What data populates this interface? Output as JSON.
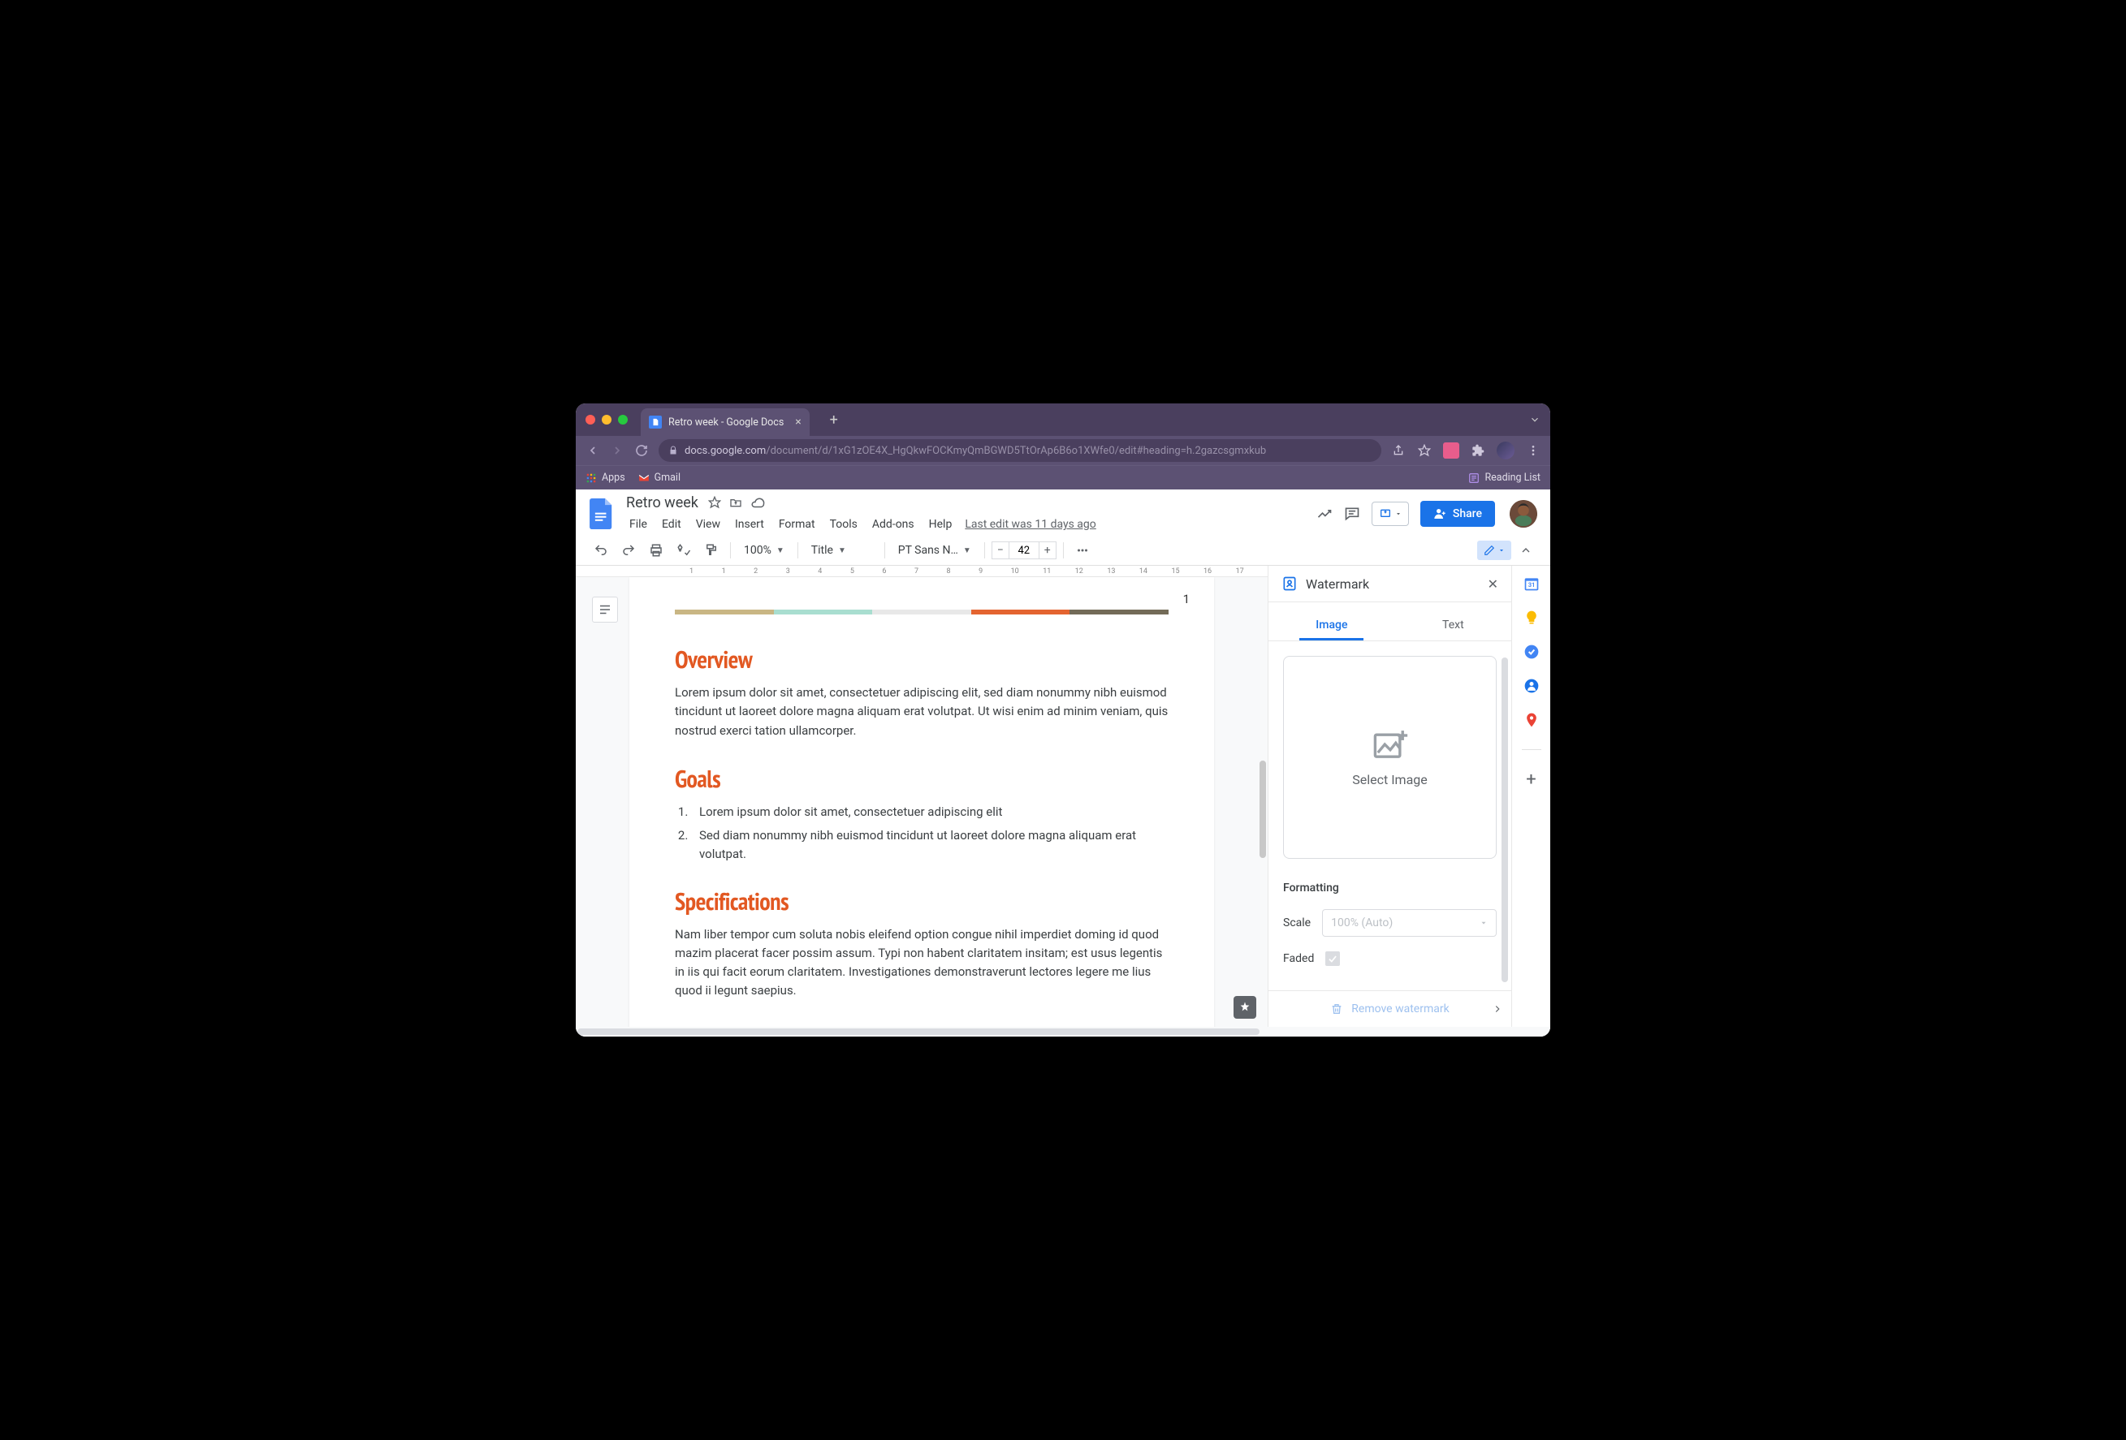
{
  "browser": {
    "tab_title": "Retro week - Google Docs",
    "url_host": "docs.google.com",
    "url_path": "/document/d/1xG1zOE4X_HgQkwFOCKmyQmBGWD5TtOrAp6B6o1XWfe0/edit#heading=h.2gazcsgmxkub",
    "bookmarks": {
      "apps": "Apps",
      "gmail": "Gmail",
      "reading_list": "Reading List"
    }
  },
  "docs": {
    "title": "Retro week",
    "menus": [
      "File",
      "Edit",
      "View",
      "Insert",
      "Format",
      "Tools",
      "Add-ons",
      "Help"
    ],
    "last_edit": "Last edit was 11 days ago",
    "share_label": "Share",
    "toolbar": {
      "zoom": "100%",
      "style": "Title",
      "font": "PT Sans N…",
      "font_size": "42"
    }
  },
  "document": {
    "page_number": "1",
    "sections": [
      {
        "title": "Overview",
        "body": "Lorem ipsum dolor sit amet, consectetuer adipiscing elit, sed diam nonummy nibh euismod tincidunt ut laoreet dolore magna aliquam erat volutpat. Ut wisi enim ad minim veniam, quis nostrud exerci tation ullamcorper."
      },
      {
        "title": "Goals",
        "list": [
          "Lorem ipsum dolor sit amet, consectetuer adipiscing elit",
          "Sed diam nonummy nibh euismod tincidunt ut laoreet dolore magna aliquam erat volutpat."
        ]
      },
      {
        "title": "Specifications",
        "body": "Nam liber tempor cum soluta nobis eleifend option congue nihil imperdiet doming id quod mazim placerat facer possim assum. Typi non habent claritatem insitam; est usus legentis in iis qui facit eorum claritatem. Investigationes demonstraverunt lectores legere me lius quod ii legunt saepius."
      }
    ]
  },
  "watermark": {
    "title": "Watermark",
    "tab_image": "Image",
    "tab_text": "Text",
    "select_image": "Select Image",
    "formatting": "Formatting",
    "scale_label": "Scale",
    "scale_value": "100% (Auto)",
    "faded_label": "Faded",
    "remove_label": "Remove watermark"
  },
  "ruler_marks": [
    "1",
    "1",
    "2",
    "3",
    "4",
    "5",
    "6",
    "7",
    "8",
    "9",
    "10",
    "11",
    "12",
    "13",
    "14",
    "15",
    "16",
    "17"
  ]
}
